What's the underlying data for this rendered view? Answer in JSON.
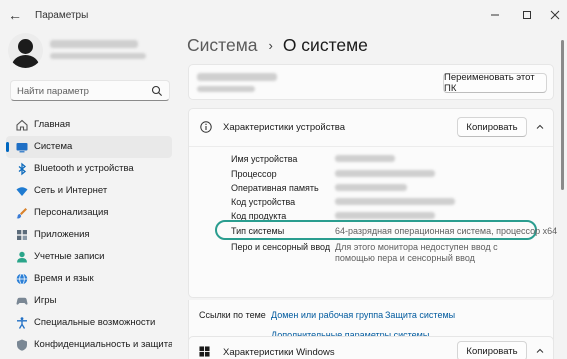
{
  "window": {
    "title": "Параметры"
  },
  "sidebar": {
    "search_placeholder": "Найти параметр",
    "items": [
      {
        "label": "Главная",
        "icon": "home-icon"
      },
      {
        "label": "Система",
        "icon": "system-icon",
        "active": true
      },
      {
        "label": "Bluetooth и устройства",
        "icon": "bluetooth-icon"
      },
      {
        "label": "Сеть и Интернет",
        "icon": "wifi-icon"
      },
      {
        "label": "Персонализация",
        "icon": "brush-icon"
      },
      {
        "label": "Приложения",
        "icon": "apps-icon"
      },
      {
        "label": "Учетные записи",
        "icon": "account-icon"
      },
      {
        "label": "Время и язык",
        "icon": "globe-icon"
      },
      {
        "label": "Игры",
        "icon": "gamepad-icon"
      },
      {
        "label": "Специальные возможности",
        "icon": "accessibility-icon"
      },
      {
        "label": "Конфиденциальность и защита",
        "icon": "shield-icon"
      }
    ]
  },
  "main": {
    "breadcrumb_parent": "Система",
    "breadcrumb_separator": "›",
    "breadcrumb_current": "О системе",
    "rename_button": "Переименовать этот ПК",
    "device_specs": {
      "title": "Характеристики устройства",
      "copy_button": "Копировать",
      "rows": [
        {
          "label": "Имя устройства",
          "value": ""
        },
        {
          "label": "Процессор",
          "value": ""
        },
        {
          "label": "Оперативная память",
          "value": ""
        },
        {
          "label": "Код устройства",
          "value": ""
        },
        {
          "label": "Код продукта",
          "value": ""
        },
        {
          "label": "Тип системы",
          "value": "64-разрядная операционная система, процессор x64"
        },
        {
          "label": "Перо и сенсорный ввод",
          "value": "Для этого монитора недоступен ввод с помощью пера и сенсорный ввод"
        }
      ],
      "highlight_color": "#2a9d8f"
    },
    "related_links": {
      "title": "Ссылки по теме",
      "links": [
        "Домен или рабочая группа",
        "Защита системы",
        "Дополнительные параметры системы"
      ]
    },
    "windows_specs": {
      "title": "Характеристики Windows",
      "copy_button": "Копировать"
    }
  },
  "colors": {
    "accent": "#0067c0",
    "link": "#005a9e",
    "highlight": "#2a9d8f"
  }
}
